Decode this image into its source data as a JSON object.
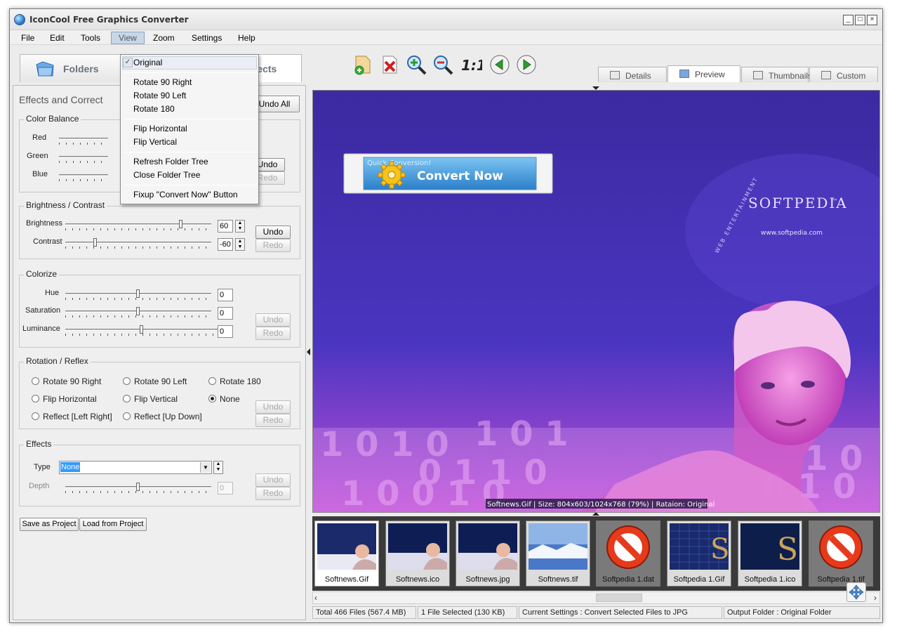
{
  "window": {
    "title": "IconCool Free Graphics Converter",
    "buttons": [
      "_",
      "□",
      "×"
    ]
  },
  "menu": [
    "File",
    "Edit",
    "Tools",
    "View",
    "Zoom",
    "Settings",
    "Help"
  ],
  "view_menu": {
    "items": [
      {
        "label": "Original",
        "checked": true
      },
      {
        "label": "Rotate 90 Right"
      },
      {
        "label": "Rotate 90 Left"
      },
      {
        "label": "Rotate 180"
      },
      {
        "label": "Flip Horizontal"
      },
      {
        "label": "Flip Vertical"
      },
      {
        "label": "Refresh Folder Tree"
      },
      {
        "label": "Close Folder Tree"
      },
      {
        "label": "Fixup \"Convert Now\" Button"
      }
    ]
  },
  "main_tabs": {
    "folders": "Folders",
    "effects": "ffects"
  },
  "toolbar": [
    "add-file-icon",
    "delete-icon",
    "zoom-in-icon",
    "zoom-out-icon",
    "actual-size-icon",
    "previous-icon",
    "next-icon"
  ],
  "toolbar_actual_size": "1:1",
  "view_tabs": {
    "details": "Details",
    "preview": "Preview",
    "thumbnails": "Thumbnails",
    "custom": "Custom"
  },
  "effects_panel": {
    "title": "Effects and Correct",
    "undo_all": "Undo All",
    "color_balance": {
      "legend": "Color Balance",
      "labels": {
        "red": "Red",
        "green": "Green",
        "blue": "Blue"
      },
      "levels": {
        "red": 0.5,
        "green": 0.5,
        "blue": 0.5
      },
      "undo": "Undo",
      "redo": "Redo"
    },
    "brightness_contrast": {
      "legend": "Brightness / Contrast",
      "brightness_label": "Brightness",
      "brightness_value": "60",
      "brightness_level": 0.8,
      "contrast_label": "Contrast",
      "contrast_value": "-60",
      "contrast_level": 0.2,
      "undo": "Undo",
      "redo": "Redo"
    },
    "colorize": {
      "legend": "Colorize",
      "hue_label": "Hue",
      "hue_value": "0",
      "hue_level": 0.5,
      "saturation_label": "Saturation",
      "saturation_value": "0",
      "saturation_level": 0.5,
      "luminance_label": "Luminance",
      "luminance_value": "0",
      "luminance_level": 0.5,
      "undo": "Undo",
      "redo": "Redo"
    },
    "rotation": {
      "legend": "Rotation / Reflex",
      "options": [
        "Rotate 90 Right",
        "Rotate 90 Left",
        "Rotate 180",
        "Flip Horizontal",
        "Flip Vertical",
        "None",
        "Reflect [Left Right]",
        "Reflect [Up Down]"
      ],
      "selected": "None",
      "undo": "Undo",
      "redo": "Redo"
    },
    "effects": {
      "legend": "Effects",
      "type_label": "Type",
      "type_value": "None",
      "depth_label": "Depth",
      "depth_value": "0",
      "depth_level": 0.5,
      "undo": "Undo",
      "redo": "Redo"
    },
    "save_project": "Save as Project",
    "load_project": "Load from Project"
  },
  "preview": {
    "banner_small": "Quick Conversion!",
    "banner_big": "Convert Now",
    "brand": "SOFTPEDIA",
    "brand_tm": "™",
    "brand_url": "www.softpedia.com",
    "brand_arc": "WEB ENTERTAINMENT",
    "info": "Softnews.Gif  |  Size: 804x603/1024x768 (79%)  |  Rataion: Original",
    "colors": {
      "bg_top": "#3b2aa0",
      "bg_bottom": "#c24fd8",
      "banner": "#4aa3e0"
    }
  },
  "thumbnails": [
    {
      "name": "Softnews.Gif",
      "kind": "photo",
      "selected": true
    },
    {
      "name": "Softnews.ico",
      "kind": "photo"
    },
    {
      "name": "Softnews.jpg",
      "kind": "photo"
    },
    {
      "name": "Softnews.tif",
      "kind": "landscape"
    },
    {
      "name": "Softpedia 1.dat",
      "kind": "forbidden"
    },
    {
      "name": "Softpedia 1.Gif",
      "kind": "logo-grid"
    },
    {
      "name": "Softpedia 1.ico",
      "kind": "logo"
    },
    {
      "name": "Softpedia 1.tif",
      "kind": "forbidden"
    }
  ],
  "status": {
    "total": "Total 466 Files (567.4 MB)",
    "selected": "1 File Selected (130 KB)",
    "settings": "Current Settings : Convert Selected Files to JPG",
    "output": "Output Folder : Original Folder"
  }
}
